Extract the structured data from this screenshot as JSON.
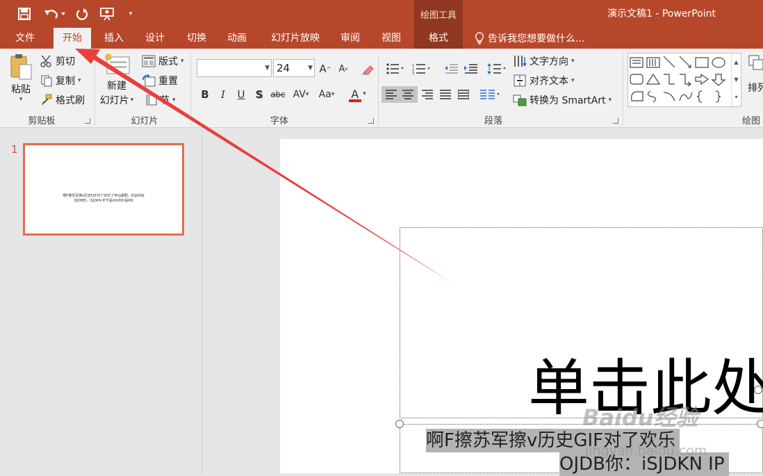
{
  "window": {
    "title": "演示文稿1 - PowerPoint"
  },
  "contextual_tools": {
    "header": "绘图工具",
    "tab": "格式"
  },
  "quick_access": [
    {
      "icon": "save-icon"
    },
    {
      "icon": "undo-icon"
    },
    {
      "icon": "redo-icon"
    },
    {
      "icon": "present-from-start-icon"
    },
    {
      "icon": "customize-qat-icon"
    }
  ],
  "tabs": [
    {
      "label": "文件"
    },
    {
      "label": "开始"
    },
    {
      "label": "插入"
    },
    {
      "label": "设计"
    },
    {
      "label": "切换"
    },
    {
      "label": "动画"
    },
    {
      "label": "幻灯片放映"
    },
    {
      "label": "审阅"
    },
    {
      "label": "视图"
    }
  ],
  "tell_me": "告诉我您想要做什么...",
  "ribbon": {
    "clipboard": {
      "paste": "粘贴",
      "cut": "剪切",
      "copy": "复制",
      "format_painter": "格式刷",
      "label": "剪贴板"
    },
    "slides": {
      "new_slide_line1": "新建",
      "new_slide_line2": "幻灯片",
      "layout": "版式",
      "reset": "重置",
      "section": "节",
      "label": "幻灯片"
    },
    "font": {
      "family": "",
      "size": "24",
      "label": "字体"
    },
    "paragraph": {
      "text_direction": "文字方向",
      "align_text": "对齐文本",
      "smartart": "转换为 SmartArt",
      "label": "段落"
    },
    "drawing": {
      "arrange": "排列",
      "label": "绘图"
    }
  },
  "slides": [
    {
      "number": "1",
      "line1": "啊F擦苏军擦v历史GIF对了欢乐了MUJ歌剧，KSJDKN",
      "line2": "OJDB你，iSJDKN IP卡是ASVND是KN"
    }
  ],
  "slide": {
    "title": "单击此处",
    "subtitle_line1": "啊F擦苏军擦v历史GIF对了欢乐",
    "subtitle_line2": "OJDB你：iSJDKN IP"
  },
  "watermark": {
    "brand": "Baidu经验",
    "url": "jingyan.baidu.com"
  },
  "colors": {
    "accent": "#b7472a",
    "contextual": "#8f3720",
    "arrow": "#e8403a"
  }
}
